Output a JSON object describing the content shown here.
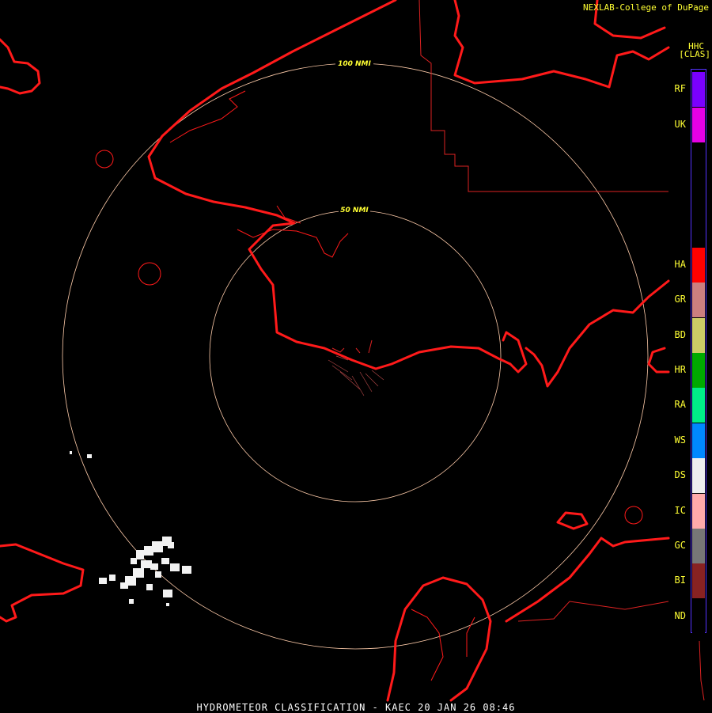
{
  "header": {
    "credit": "NEXLAB-College of DuPage",
    "product_code": "HHC",
    "product_abbrev": "[CLAS]"
  },
  "footer": {
    "title": "HYDROMETEOR CLASSIFICATION - KAEC 20 JAN 26 08:46"
  },
  "range_rings": [
    {
      "label": "100 NMI"
    },
    {
      "label": "50 NMI"
    }
  ],
  "legend": {
    "items": [
      {
        "code": "RF",
        "color": "#7a00ff"
      },
      {
        "code": "UK",
        "color": "#e600e6"
      },
      {
        "code": "HA",
        "color": "#ff0000"
      },
      {
        "code": "GR",
        "color": "#cc7f7f"
      },
      {
        "code": "BD",
        "color": "#cccc66"
      },
      {
        "code": "HR",
        "color": "#00aa00"
      },
      {
        "code": "RA",
        "color": "#00ee88"
      },
      {
        "code": "WS",
        "color": "#0088ff"
      },
      {
        "code": "DS",
        "color": "#eeeeee"
      },
      {
        "code": "IC",
        "color": "#ffaaaa"
      },
      {
        "code": "GC",
        "color": "#777777"
      },
      {
        "code": "BI",
        "color": "#882222"
      },
      {
        "code": "ND",
        "color": "#000000"
      }
    ]
  },
  "colors": {
    "coastline": "#ff1a1a",
    "border": "#dd2222",
    "range_ring": "#ffccaa",
    "echo": "#f2f2f2"
  }
}
